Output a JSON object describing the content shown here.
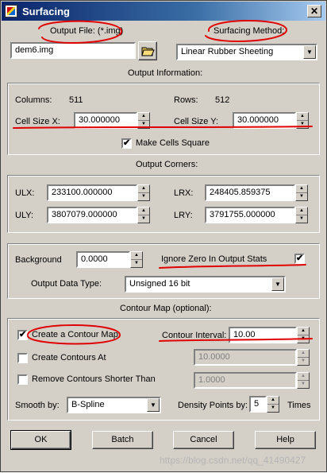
{
  "window": {
    "title": "Surfacing",
    "close_glyph": "✕"
  },
  "output_file": {
    "label": "Output File: (*.img)",
    "value": "dem6.img"
  },
  "surfacing_method": {
    "label": "Surfacing Method:",
    "value": "Linear Rubber Sheeting"
  },
  "output_information": {
    "header": "Output Information:",
    "columns_label": "Columns:",
    "columns_value": "511",
    "rows_label": "Rows:",
    "rows_value": "512",
    "cell_size_x_label": "Cell Size X:",
    "cell_size_x": "30.000000",
    "cell_size_y_label": "Cell Size Y:",
    "cell_size_y": "30.000000",
    "make_square_label": "Make Cells Square",
    "make_square_checked": "✔"
  },
  "output_corners": {
    "header": "Output Corners:",
    "ulx_label": "ULX:",
    "ulx": "233100.000000",
    "lrx_label": "LRX:",
    "lrx": "248405.859375",
    "uly_label": "ULY:",
    "uly": "3807079.000000",
    "lry_label": "LRY:",
    "lry": "3791755.000000"
  },
  "stats": {
    "background_label": "Background",
    "background_value": "0.0000",
    "ignore_zero_label": "Ignore Zero In Output Stats",
    "ignore_zero_checked": "✔",
    "data_type_label": "Output Data Type:",
    "data_type_value": "Unsigned 16 bit"
  },
  "contour": {
    "header": "Contour Map (optional):",
    "create_map_label": "Create a Contour Map",
    "create_map_checked": "✔",
    "interval_label": "Contour Interval:",
    "interval_value": "10.00",
    "create_at_label": "Create Contours At",
    "create_at_value": "10.0000",
    "remove_short_label": "Remove Contours Shorter Than",
    "remove_short_value": "1.0000",
    "smooth_label": "Smooth by:",
    "smooth_value": "B-Spline",
    "density_label": "Density Points by:",
    "density_value": "5",
    "density_suffix": "Times"
  },
  "buttons": {
    "ok": "OK",
    "batch": "Batch",
    "cancel": "Cancel",
    "help": "Help"
  },
  "watermark": "https://blog.csdn.net/qq_41490427",
  "colors": {
    "annotation": "#e00000",
    "titlebar": "#0a246a",
    "dialog": "#d4d0c8"
  }
}
